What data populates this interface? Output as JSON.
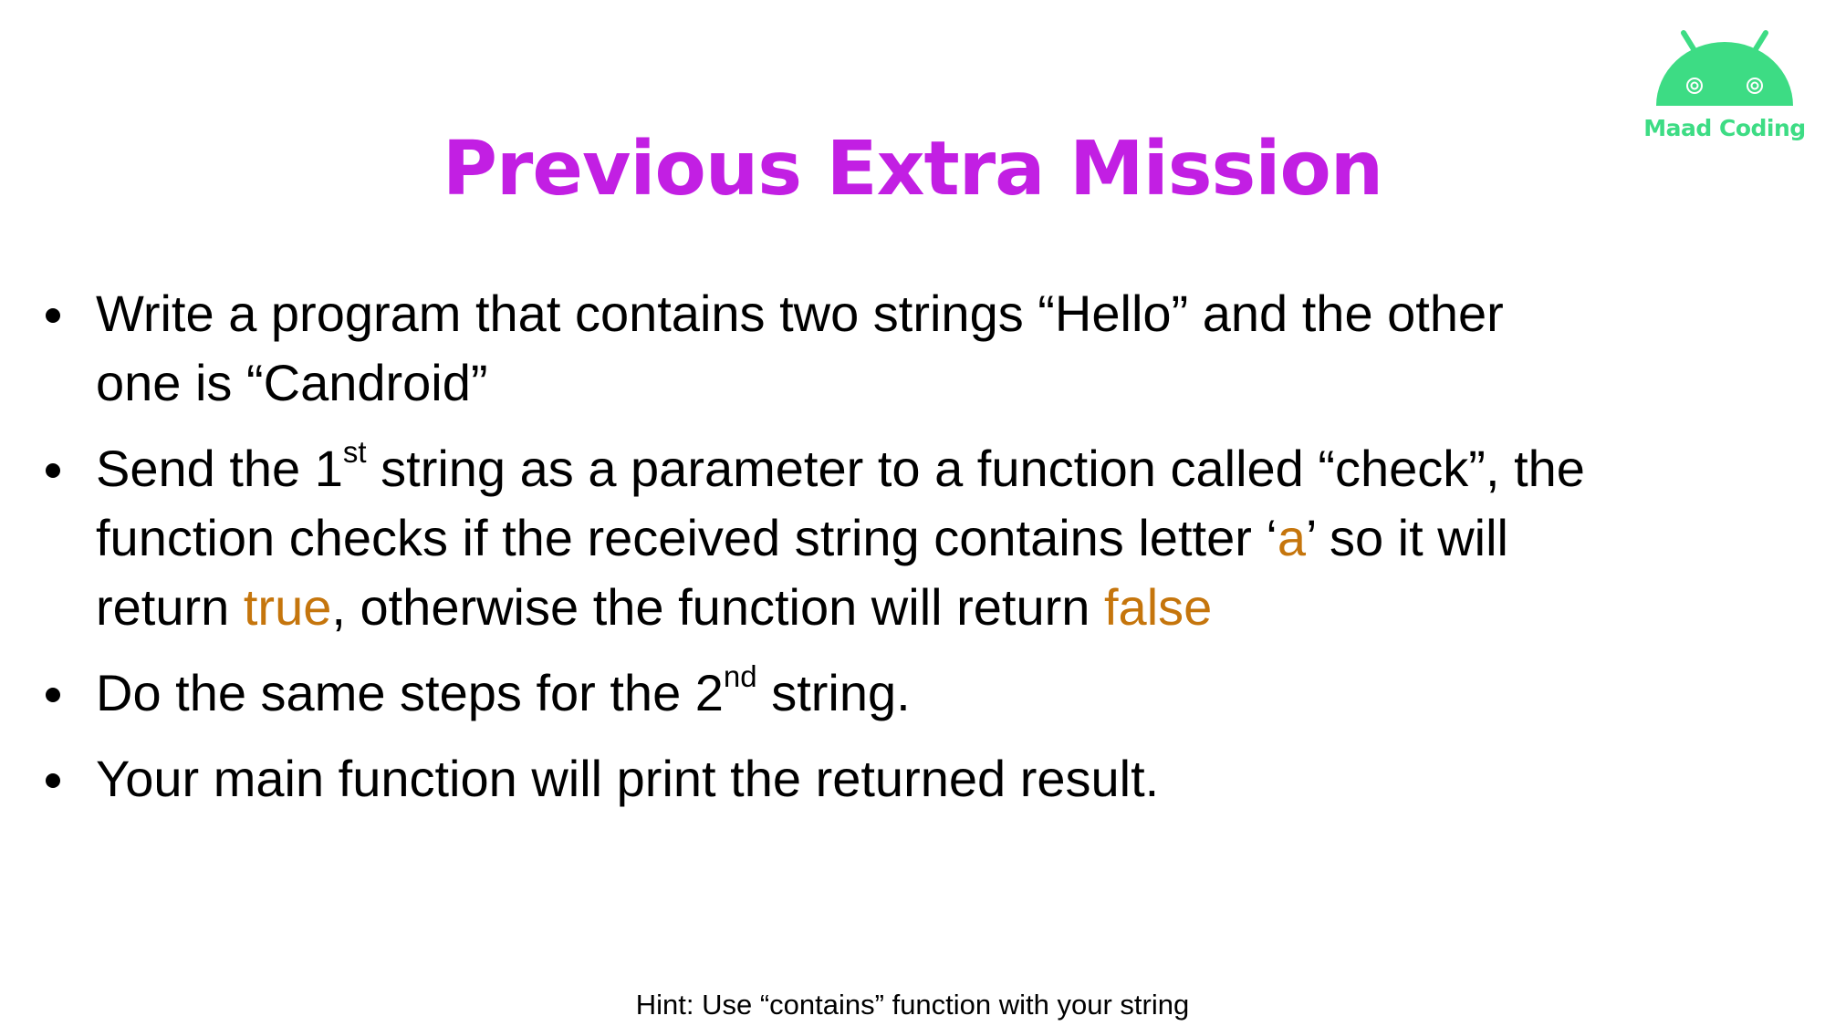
{
  "logo": {
    "icon": "android-head-icon",
    "text": "Maad Coding",
    "color": "#3ddc84"
  },
  "title": "Previous Extra Mission",
  "title_color": "#c21fe3",
  "accent_color": "#c5750c",
  "bullets": [
    {
      "line1": "Write a program that contains two strings “Hello” and the other",
      "line2": "one is “Candroid”"
    },
    {
      "l1_a": "Send the 1",
      "l1_sup": "st",
      "l1_b": " string as a parameter to a function called “check”, the",
      "l2_a": "function checks if the received string contains letter ‘",
      "l2_accent": "a",
      "l2_b": "’ so it will",
      "l3_a": "return ",
      "l3_accent1": "true",
      "l3_b": ", otherwise the function will return ",
      "l3_accent2": "false"
    },
    {
      "a": "Do the same steps for the 2",
      "sup": "nd",
      "b": " string."
    },
    {
      "text": "Your main function will print the returned result."
    }
  ],
  "hint": "Hint: Use “contains” function with your string"
}
